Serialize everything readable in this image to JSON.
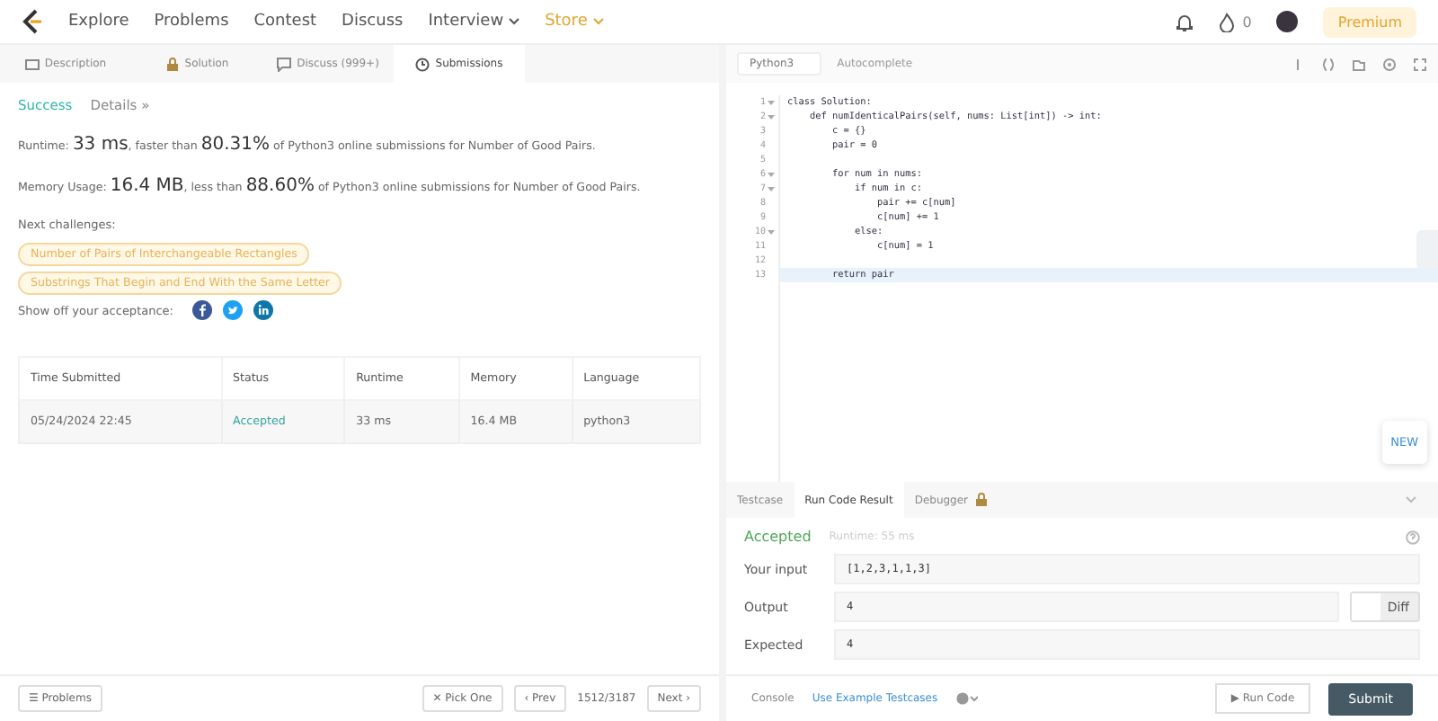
{
  "nav": {
    "links": [
      {
        "label": "Explore",
        "kind": "plain"
      },
      {
        "label": "Problems",
        "kind": "plain"
      },
      {
        "label": "Contest",
        "kind": "plain"
      },
      {
        "label": "Discuss",
        "kind": "plain"
      },
      {
        "label": "Interview",
        "kind": "dropdown"
      },
      {
        "label": "Store",
        "kind": "store"
      }
    ],
    "streak": "0",
    "premium": "Premium"
  },
  "left_tabs": [
    {
      "label": "Description",
      "selected": false
    },
    {
      "label": "Solution",
      "selected": false
    },
    {
      "label": "Discuss (999+)",
      "selected": false
    },
    {
      "label": "Submissions",
      "selected": true
    }
  ],
  "result": {
    "status": "Success",
    "details": "Details »",
    "runtime": "Runtime: **33 ms**, faster than **80.31%** of Python3 online submissions for Number of Good Pairs.",
    "memory": "Memory Usage: **16.4 MB**, less than **88.60%** of Python3 online submissions for Number of Good Pairs.",
    "next_label": "Next challenges:",
    "challenges": [
      "Number of Pairs of Interchangeable Rectangles",
      "Substrings That Begin and End With the Same Letter"
    ],
    "share_label": "Show off your acceptance:"
  },
  "table": {
    "columns": [
      "Time Submitted",
      "Status",
      "Runtime",
      "Memory",
      "Language"
    ],
    "rows": [
      [
        "05/24/2024 22:45",
        "Accepted",
        "33 ms",
        "16.4 MB",
        "python3"
      ]
    ]
  },
  "left_footer": {
    "problems": "☰ Problems",
    "pick": "✕ Pick One",
    "prev": "‹ Prev",
    "page": "1512/3187",
    "next": "Next ›"
  },
  "editor": {
    "language": "Python3",
    "autocomplete": "Autocomplete",
    "new_badge": "NEW",
    "lines": [
      {
        "no": "1",
        "text": "class Solution:",
        "fold": true,
        "active": false
      },
      {
        "no": "2",
        "text": "    def numIdenticalPairs(self, nums: List[int]) -> int:",
        "fold": true,
        "active": false
      },
      {
        "no": "3",
        "text": "        c = {}",
        "fold": false,
        "active": false
      },
      {
        "no": "4",
        "text": "        pair = 0",
        "fold": false,
        "active": false
      },
      {
        "no": "5",
        "fold": false,
        "active": false
      },
      {
        "no": "6",
        "text": "        for num in nums:",
        "fold": true,
        "active": false
      },
      {
        "no": "7",
        "text": "            if num in c:",
        "fold": true,
        "active": false
      },
      {
        "no": "8",
        "text": "                pair += c[num]",
        "fold": false,
        "active": false
      },
      {
        "no": "9",
        "text": "                c[num] += 1",
        "fold": false,
        "active": false
      },
      {
        "no": "10",
        "text": "            else:",
        "fold": true,
        "active": false
      },
      {
        "no": "11",
        "text": "                c[num] = 1",
        "fold": false,
        "active": false
      },
      {
        "no": "12",
        "fold": false,
        "active": false
      },
      {
        "no": "13",
        "text": "        return pair",
        "fold": false,
        "active": true
      }
    ]
  },
  "console": {
    "tabs": [
      {
        "label": "Testcase",
        "selected": false
      },
      {
        "label": "Run Code Result",
        "selected": true
      },
      {
        "label": "Debugger",
        "selected": false
      }
    ],
    "status": "Accepted",
    "runtime": "Runtime: 55 ms",
    "fields": [
      {
        "label": "Your input",
        "value": "[1,2,3,1,1,3]"
      },
      {
        "label": "Output",
        "value": "4"
      },
      {
        "label": "Expected",
        "value": "4"
      }
    ],
    "diff": "Diff"
  },
  "right_footer": {
    "console": "Console",
    "example": "Use Example Testcases",
    "run": "▶ Run Code",
    "submit": "Submit"
  }
}
